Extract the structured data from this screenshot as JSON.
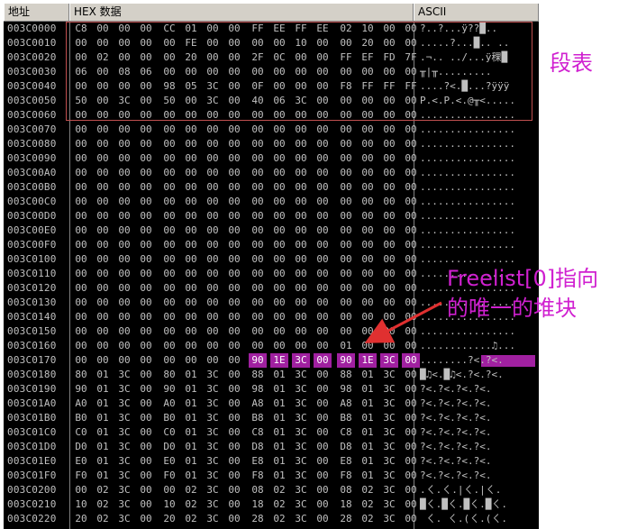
{
  "header": {
    "address": "地址",
    "hex": "HEX 数据",
    "ascii": "ASCII"
  },
  "rows": [
    {
      "addr": "003C0000",
      "bytes": [
        "C8",
        "00",
        "00",
        "00",
        "CC",
        "01",
        "00",
        "00",
        "FF",
        "EE",
        "FF",
        "EE",
        "02",
        "10",
        "00",
        "00"
      ],
      "ascii": "?..?...ÿ??█.."
    },
    {
      "addr": "003C0010",
      "bytes": [
        "00",
        "00",
        "00",
        "00",
        "00",
        "FE",
        "00",
        "00",
        "00",
        "00",
        "10",
        "00",
        "00",
        "20",
        "00",
        "00"
      ],
      "ascii": ".....?...█.. .."
    },
    {
      "addr": "003C0020",
      "bytes": [
        "00",
        "02",
        "00",
        "00",
        "00",
        "20",
        "00",
        "00",
        "2F",
        "0C",
        "00",
        "00",
        "FF",
        "EF",
        "FD",
        "7F"
      ],
      "ascii": ".¬.. ../...ÿ稞█"
    },
    {
      "addr": "003C0030",
      "bytes": [
        "06",
        "00",
        "08",
        "06",
        "00",
        "00",
        "00",
        "00",
        "00",
        "00",
        "00",
        "00",
        "00",
        "00",
        "00",
        "00"
      ],
      "ascii": "╥|╥........."
    },
    {
      "addr": "003C0040",
      "bytes": [
        "00",
        "00",
        "00",
        "00",
        "98",
        "05",
        "3C",
        "00",
        "0F",
        "00",
        "00",
        "00",
        "F8",
        "FF",
        "FF",
        "FF"
      ],
      "ascii": "....?<.█...?ÿÿÿ"
    },
    {
      "addr": "003C0050",
      "bytes": [
        "50",
        "00",
        "3C",
        "00",
        "50",
        "00",
        "3C",
        "00",
        "40",
        "06",
        "3C",
        "00",
        "00",
        "00",
        "00",
        "00"
      ],
      "ascii": "P.<.P.<.@╥<....."
    },
    {
      "addr": "003C0060",
      "bytes": [
        "00",
        "00",
        "00",
        "00",
        "00",
        "00",
        "00",
        "00",
        "00",
        "00",
        "00",
        "00",
        "00",
        "00",
        "00",
        "00"
      ],
      "ascii": "................"
    },
    {
      "addr": "003C0070",
      "bytes": [
        "00",
        "00",
        "00",
        "00",
        "00",
        "00",
        "00",
        "00",
        "00",
        "00",
        "00",
        "00",
        "00",
        "00",
        "00",
        "00"
      ],
      "ascii": "................"
    },
    {
      "addr": "003C0080",
      "bytes": [
        "00",
        "00",
        "00",
        "00",
        "00",
        "00",
        "00",
        "00",
        "00",
        "00",
        "00",
        "00",
        "00",
        "00",
        "00",
        "00"
      ],
      "ascii": "................"
    },
    {
      "addr": "003C0090",
      "bytes": [
        "00",
        "00",
        "00",
        "00",
        "00",
        "00",
        "00",
        "00",
        "00",
        "00",
        "00",
        "00",
        "00",
        "00",
        "00",
        "00"
      ],
      "ascii": "................"
    },
    {
      "addr": "003C00A0",
      "bytes": [
        "00",
        "00",
        "00",
        "00",
        "00",
        "00",
        "00",
        "00",
        "00",
        "00",
        "00",
        "00",
        "00",
        "00",
        "00",
        "00"
      ],
      "ascii": "................"
    },
    {
      "addr": "003C00B0",
      "bytes": [
        "00",
        "00",
        "00",
        "00",
        "00",
        "00",
        "00",
        "00",
        "00",
        "00",
        "00",
        "00",
        "00",
        "00",
        "00",
        "00"
      ],
      "ascii": "................"
    },
    {
      "addr": "003C00C0",
      "bytes": [
        "00",
        "00",
        "00",
        "00",
        "00",
        "00",
        "00",
        "00",
        "00",
        "00",
        "00",
        "00",
        "00",
        "00",
        "00",
        "00"
      ],
      "ascii": "................"
    },
    {
      "addr": "003C00D0",
      "bytes": [
        "00",
        "00",
        "00",
        "00",
        "00",
        "00",
        "00",
        "00",
        "00",
        "00",
        "00",
        "00",
        "00",
        "00",
        "00",
        "00"
      ],
      "ascii": "................"
    },
    {
      "addr": "003C00E0",
      "bytes": [
        "00",
        "00",
        "00",
        "00",
        "00",
        "00",
        "00",
        "00",
        "00",
        "00",
        "00",
        "00",
        "00",
        "00",
        "00",
        "00"
      ],
      "ascii": "................"
    },
    {
      "addr": "003C00F0",
      "bytes": [
        "00",
        "00",
        "00",
        "00",
        "00",
        "00",
        "00",
        "00",
        "00",
        "00",
        "00",
        "00",
        "00",
        "00",
        "00",
        "00"
      ],
      "ascii": "................"
    },
    {
      "addr": "003C0100",
      "bytes": [
        "00",
        "00",
        "00",
        "00",
        "00",
        "00",
        "00",
        "00",
        "00",
        "00",
        "00",
        "00",
        "00",
        "00",
        "00",
        "00"
      ],
      "ascii": "................"
    },
    {
      "addr": "003C0110",
      "bytes": [
        "00",
        "00",
        "00",
        "00",
        "00",
        "00",
        "00",
        "00",
        "00",
        "00",
        "00",
        "00",
        "00",
        "00",
        "00",
        "00"
      ],
      "ascii": "................"
    },
    {
      "addr": "003C0120",
      "bytes": [
        "00",
        "00",
        "00",
        "00",
        "00",
        "00",
        "00",
        "00",
        "00",
        "00",
        "00",
        "00",
        "00",
        "00",
        "00",
        "00"
      ],
      "ascii": "................"
    },
    {
      "addr": "003C0130",
      "bytes": [
        "00",
        "00",
        "00",
        "00",
        "00",
        "00",
        "00",
        "00",
        "00",
        "00",
        "00",
        "00",
        "00",
        "00",
        "00",
        "00"
      ],
      "ascii": "................"
    },
    {
      "addr": "003C0140",
      "bytes": [
        "00",
        "00",
        "00",
        "00",
        "00",
        "00",
        "00",
        "00",
        "00",
        "00",
        "00",
        "00",
        "00",
        "00",
        "00",
        "00"
      ],
      "ascii": "................"
    },
    {
      "addr": "003C0150",
      "bytes": [
        "00",
        "00",
        "00",
        "00",
        "00",
        "00",
        "00",
        "00",
        "00",
        "00",
        "00",
        "00",
        "00",
        "00",
        "00",
        "00"
      ],
      "ascii": "................"
    },
    {
      "addr": "003C0160",
      "bytes": [
        "00",
        "00",
        "00",
        "00",
        "00",
        "00",
        "00",
        "00",
        "00",
        "00",
        "00",
        "00",
        "01",
        "00",
        "00",
        "00"
      ],
      "ascii": "............♫..."
    },
    {
      "addr": "003C0170",
      "bytes": [
        "00",
        "00",
        "00",
        "00",
        "00",
        "00",
        "00",
        "00",
        "90",
        "1E",
        "3C",
        "00",
        "90",
        "1E",
        "3C",
        "00"
      ],
      "ascii": "........?<.?<.",
      "hl": [
        8,
        9,
        10,
        11,
        12,
        13,
        14,
        15
      ]
    },
    {
      "addr": "003C0180",
      "bytes": [
        "80",
        "01",
        "3C",
        "00",
        "80",
        "01",
        "3C",
        "00",
        "88",
        "01",
        "3C",
        "00",
        "88",
        "01",
        "3C",
        "00"
      ],
      "ascii": "█♫<.█♫<.?<.?<."
    },
    {
      "addr": "003C0190",
      "bytes": [
        "90",
        "01",
        "3C",
        "00",
        "90",
        "01",
        "3C",
        "00",
        "98",
        "01",
        "3C",
        "00",
        "98",
        "01",
        "3C",
        "00"
      ],
      "ascii": "?<.?<.?<.?<."
    },
    {
      "addr": "003C01A0",
      "bytes": [
        "A0",
        "01",
        "3C",
        "00",
        "A0",
        "01",
        "3C",
        "00",
        "A8",
        "01",
        "3C",
        "00",
        "A8",
        "01",
        "3C",
        "00"
      ],
      "ascii": "?<.?<.?<.?<."
    },
    {
      "addr": "003C01B0",
      "bytes": [
        "B0",
        "01",
        "3C",
        "00",
        "B0",
        "01",
        "3C",
        "00",
        "B8",
        "01",
        "3C",
        "00",
        "B8",
        "01",
        "3C",
        "00"
      ],
      "ascii": "?<.?<.?<.?<."
    },
    {
      "addr": "003C01C0",
      "bytes": [
        "C0",
        "01",
        "3C",
        "00",
        "C0",
        "01",
        "3C",
        "00",
        "C8",
        "01",
        "3C",
        "00",
        "C8",
        "01",
        "3C",
        "00"
      ],
      "ascii": "?<.?<.?<.?<."
    },
    {
      "addr": "003C01D0",
      "bytes": [
        "D0",
        "01",
        "3C",
        "00",
        "D0",
        "01",
        "3C",
        "00",
        "D8",
        "01",
        "3C",
        "00",
        "D8",
        "01",
        "3C",
        "00"
      ],
      "ascii": "?<.?<.?<.?<."
    },
    {
      "addr": "003C01E0",
      "bytes": [
        "E0",
        "01",
        "3C",
        "00",
        "E0",
        "01",
        "3C",
        "00",
        "E8",
        "01",
        "3C",
        "00",
        "E8",
        "01",
        "3C",
        "00"
      ],
      "ascii": "?<.?<.?<.?<."
    },
    {
      "addr": "003C01F0",
      "bytes": [
        "F0",
        "01",
        "3C",
        "00",
        "F0",
        "01",
        "3C",
        "00",
        "F8",
        "01",
        "3C",
        "00",
        "F8",
        "01",
        "3C",
        "00"
      ],
      "ascii": "?<.?<.?<.?<."
    },
    {
      "addr": "003C0200",
      "bytes": [
        "00",
        "02",
        "3C",
        "00",
        "00",
        "02",
        "3C",
        "00",
        "08",
        "02",
        "3C",
        "00",
        "08",
        "02",
        "3C",
        "00"
      ],
      "ascii": ".ㄑ.ㄑ.|ㄑ.|ㄑ."
    },
    {
      "addr": "003C0210",
      "bytes": [
        "10",
        "02",
        "3C",
        "00",
        "10",
        "02",
        "3C",
        "00",
        "18",
        "02",
        "3C",
        "00",
        "18",
        "02",
        "3C",
        "00"
      ],
      "ascii": "█ㄑ.█ㄑ.█ㄑ.█ㄑ."
    },
    {
      "addr": "003C0220",
      "bytes": [
        "20",
        "02",
        "3C",
        "00",
        "20",
        "02",
        "3C",
        "00",
        "28",
        "02",
        "3C",
        "00",
        "28",
        "02",
        "3C",
        "00"
      ],
      "ascii": " ㄑ. ㄑ.(ㄑ.(ㄑ."
    }
  ],
  "annotations": {
    "segment_table": "段表",
    "freelist_line1": "Freelist[0]指向",
    "freelist_line2": "的唯一的堆块"
  },
  "colors": {
    "highlight": "#a020a0",
    "annotation": "#d020d0",
    "box": "#c05050"
  }
}
